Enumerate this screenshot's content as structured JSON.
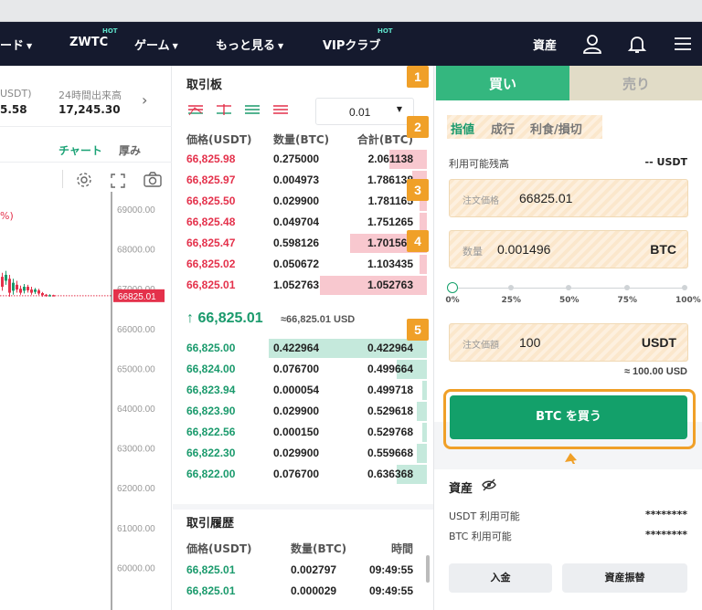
{
  "nav": {
    "left_label": "ード",
    "items": [
      {
        "label": "ZWTC",
        "hot": "HOT"
      },
      {
        "label": "ゲーム"
      },
      {
        "label": "もっと見る"
      },
      {
        "label": "VIPクラブ",
        "hot": "HOT"
      }
    ],
    "assets": "資産"
  },
  "ticker": {
    "col1_label": "USDT)",
    "col1_value": "5.58",
    "col2_label": "24時間出来高",
    "col2_value": "17,245.30"
  },
  "chart_tabs": {
    "chart": "チャート",
    "depth": "厚み"
  },
  "chart": {
    "pct_marker": "%)",
    "price_ticks": [
      "69000.00",
      "68000.00",
      "67000.00",
      "66000.00",
      "65000.00",
      "64000.00",
      "63000.00",
      "62000.00",
      "61000.00",
      "60000.00"
    ],
    "current_price_tag": "66825.01"
  },
  "orderbook": {
    "title": "取引板",
    "precision": "0.01",
    "headers": {
      "price": "価格(USDT)",
      "qty": "数量(BTC)",
      "total": "合計(BTC)"
    },
    "asks": [
      {
        "price": "66,825.98",
        "qty": "0.275000",
        "total": "2.061138",
        "depth": 0.15
      },
      {
        "price": "66,825.97",
        "qty": "0.004973",
        "total": "1.786138",
        "depth": 0.06
      },
      {
        "price": "66,825.50",
        "qty": "0.029900",
        "total": "1.781165",
        "depth": 0.03
      },
      {
        "price": "66,825.48",
        "qty": "0.049704",
        "total": "1.751265",
        "depth": 0.03
      },
      {
        "price": "66,825.47",
        "qty": "0.598126",
        "total": "1.701561",
        "depth": 0.31
      },
      {
        "price": "66,825.02",
        "qty": "0.050672",
        "total": "1.103435",
        "depth": 0.03
      },
      {
        "price": "66,825.01",
        "qty": "1.052763",
        "total": "1.052763",
        "depth": 0.43
      }
    ],
    "last_price": "66,825.01",
    "last_price_arrow": "↑",
    "last_price_usd": "≈66,825.01 USD",
    "bids": [
      {
        "price": "66,825.00",
        "qty": "0.422964",
        "total": "0.422964",
        "depth": 0.64
      },
      {
        "price": "66,824.00",
        "qty": "0.076700",
        "total": "0.499664",
        "depth": 0.12
      },
      {
        "price": "66,823.94",
        "qty": "0.000054",
        "total": "0.499718",
        "depth": 0.02
      },
      {
        "price": "66,823.90",
        "qty": "0.029900",
        "total": "0.529618",
        "depth": 0.04
      },
      {
        "price": "66,822.56",
        "qty": "0.000150",
        "total": "0.529768",
        "depth": 0.02
      },
      {
        "price": "66,822.30",
        "qty": "0.029900",
        "total": "0.559668",
        "depth": 0.04
      },
      {
        "price": "66,822.00",
        "qty": "0.076700",
        "total": "0.636368",
        "depth": 0.12
      }
    ]
  },
  "trades": {
    "title": "取引履歴",
    "headers": {
      "price": "価格(USDT)",
      "qty": "数量(BTC)",
      "time": "時間"
    },
    "rows": [
      {
        "price": "66,825.01",
        "qty": "0.002797",
        "time": "09:49:55"
      },
      {
        "price": "66,825.01",
        "qty": "0.000029",
        "time": "09:49:55"
      }
    ]
  },
  "trade_panel": {
    "buy_tab": "買い",
    "sell_tab": "売り",
    "order_types": [
      "指値",
      "成行",
      "利食/損切"
    ],
    "balance_label": "利用可能残高",
    "balance_value": "-- USDT",
    "price_label": "注文価格",
    "price_value": "66825.01",
    "qty_label": "数量",
    "qty_value": "0.001496",
    "qty_unit": "BTC",
    "slider_marks": [
      "0%",
      "25%",
      "50%",
      "75%",
      "100%"
    ],
    "slider_value": 0,
    "amount_label": "注文価額",
    "amount_value": "100",
    "amount_unit": "USDT",
    "approx": "≈ 100.00 USD",
    "buy_button": "BTC を買う"
  },
  "assets_panel": {
    "title": "資産",
    "usdt_label": "USDT 利用可能",
    "usdt_value": "********",
    "btc_label": "BTC 利用可能",
    "btc_value": "********",
    "deposit": "入金",
    "transfer": "資産振替"
  },
  "badges": [
    "1",
    "2",
    "3",
    "4",
    "5"
  ],
  "colors": {
    "buy": "#13a06a",
    "sell": "#e4314b",
    "nav_bg": "#151a2e",
    "badge": "#f0a028"
  }
}
